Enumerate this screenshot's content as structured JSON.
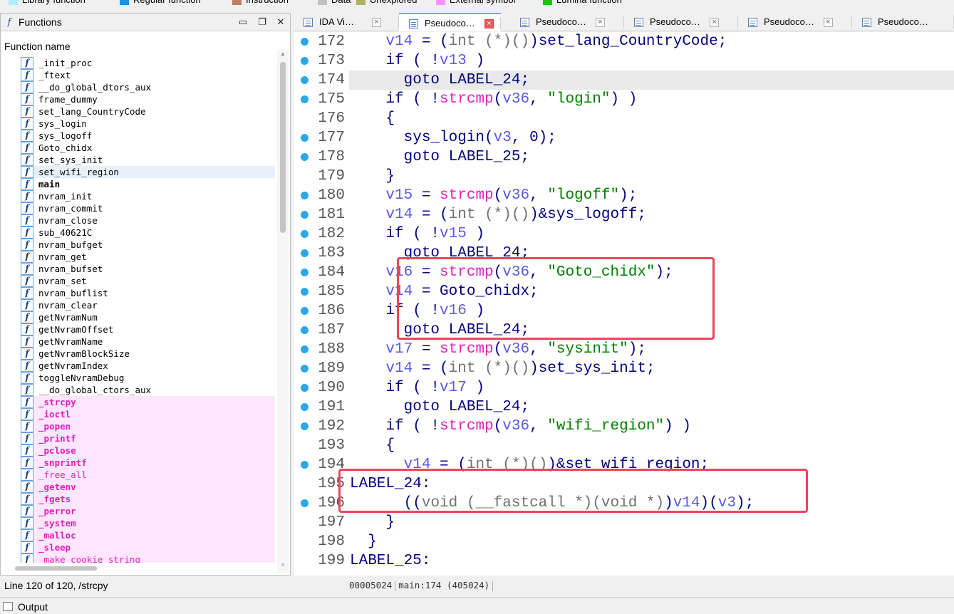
{
  "legend": [
    {
      "label": "Library function",
      "color": "#aeeeff"
    },
    {
      "label": "Regular function",
      "color": "#1e90e0"
    },
    {
      "label": "Instruction",
      "color": "#c08060"
    },
    {
      "label": "Data",
      "color": "#c0c0c0"
    },
    {
      "label": "Unexplored",
      "color": "#b0b060"
    },
    {
      "label": "External symbol",
      "color": "#ff90ff"
    },
    {
      "label": "Lumina function",
      "color": "#20c020"
    }
  ],
  "functions_panel": {
    "title": "Functions",
    "column_header": "Function name",
    "status": "Line 120 of 120, /strcpy",
    "items": [
      {
        "name": "_init_proc",
        "bold": false,
        "lib": false
      },
      {
        "name": "_ftext",
        "bold": false,
        "lib": false
      },
      {
        "name": "__do_global_dtors_aux",
        "bold": false,
        "lib": false
      },
      {
        "name": "frame_dummy",
        "bold": false,
        "lib": false
      },
      {
        "name": "set_lang_CountryCode",
        "bold": false,
        "lib": false
      },
      {
        "name": "sys_login",
        "bold": false,
        "lib": false
      },
      {
        "name": "sys_logoff",
        "bold": false,
        "lib": false
      },
      {
        "name": "Goto_chidx",
        "bold": false,
        "lib": false
      },
      {
        "name": "set_sys_init",
        "bold": false,
        "lib": false
      },
      {
        "name": "set_wifi_region",
        "bold": false,
        "lib": false,
        "selected": true
      },
      {
        "name": "main",
        "bold": true,
        "lib": false
      },
      {
        "name": "nvram_init",
        "bold": false,
        "lib": false
      },
      {
        "name": "nvram_commit",
        "bold": false,
        "lib": false
      },
      {
        "name": "nvram_close",
        "bold": false,
        "lib": false
      },
      {
        "name": "sub_40621C",
        "bold": false,
        "lib": false
      },
      {
        "name": "nvram_bufget",
        "bold": false,
        "lib": false
      },
      {
        "name": "nvram_get",
        "bold": false,
        "lib": false
      },
      {
        "name": "nvram_bufset",
        "bold": false,
        "lib": false
      },
      {
        "name": "nvram_set",
        "bold": false,
        "lib": false
      },
      {
        "name": "nvram_buflist",
        "bold": false,
        "lib": false
      },
      {
        "name": "nvram_clear",
        "bold": false,
        "lib": false
      },
      {
        "name": "getNvramNum",
        "bold": false,
        "lib": false
      },
      {
        "name": "getNvramOffset",
        "bold": false,
        "lib": false
      },
      {
        "name": "getNvramName",
        "bold": false,
        "lib": false
      },
      {
        "name": "getNvramBlockSize",
        "bold": false,
        "lib": false
      },
      {
        "name": "getNvramIndex",
        "bold": false,
        "lib": false
      },
      {
        "name": "toggleNvramDebug",
        "bold": false,
        "lib": false
      },
      {
        "name": "__do_global_ctors_aux",
        "bold": false,
        "lib": false
      },
      {
        "name": "_strcpy",
        "bold": true,
        "lib": true
      },
      {
        "name": "_ioctl",
        "bold": true,
        "lib": true
      },
      {
        "name": "_popen",
        "bold": true,
        "lib": true
      },
      {
        "name": "_printf",
        "bold": true,
        "lib": true
      },
      {
        "name": "_pclose",
        "bold": true,
        "lib": true
      },
      {
        "name": "_snprintf",
        "bold": true,
        "lib": true
      },
      {
        "name": "_free_all",
        "bold": false,
        "lib": true
      },
      {
        "name": "_getenv",
        "bold": true,
        "lib": true
      },
      {
        "name": "_fgets",
        "bold": true,
        "lib": true
      },
      {
        "name": "_perror",
        "bold": true,
        "lib": true
      },
      {
        "name": "_system",
        "bold": true,
        "lib": true
      },
      {
        "name": "_malloc",
        "bold": true,
        "lib": true
      },
      {
        "name": "_sleep",
        "bold": true,
        "lib": true
      },
      {
        "name": "_make_cookie_string",
        "bold": false,
        "lib": true
      }
    ]
  },
  "tabs": [
    {
      "label": "IDA Vi…",
      "active": false
    },
    {
      "label": "Pseudoco…",
      "active": true
    },
    {
      "label": "Pseudoco…",
      "active": false
    },
    {
      "label": "Pseudoco…",
      "active": false
    },
    {
      "label": "Pseudoco…",
      "active": false
    },
    {
      "label": "Pseudoco…",
      "active": false
    }
  ],
  "code_lines": [
    {
      "num": "172",
      "dot": true,
      "html": "    <span class=\"var\">v14</span> = (<span class=\"typ\">int</span> <span class=\"typ\">(*)()</span>)set_lang_CountryCode;"
    },
    {
      "num": "173",
      "dot": true,
      "html": "    if ( !<span class=\"var\">v13</span> )"
    },
    {
      "num": "174",
      "dot": true,
      "hl": true,
      "html": "      goto LABEL_24;"
    },
    {
      "num": "175",
      "dot": true,
      "html": "    if ( !<span class=\"lib\">strcmp</span>(<span class=\"var\">v36</span>, <span class=\"str\">\"login\"</span>) )"
    },
    {
      "num": "176",
      "dot": false,
      "html": "    {"
    },
    {
      "num": "177",
      "dot": true,
      "html": "      sys_login(<span class=\"var\">v3</span>, 0);"
    },
    {
      "num": "178",
      "dot": true,
      "html": "      goto LABEL_25;"
    },
    {
      "num": "179",
      "dot": false,
      "html": "    }"
    },
    {
      "num": "180",
      "dot": true,
      "html": "    <span class=\"var\">v15</span> = <span class=\"lib\">strcmp</span>(<span class=\"var\">v36</span>, <span class=\"str\">\"logoff\"</span>);"
    },
    {
      "num": "181",
      "dot": true,
      "html": "    <span class=\"var\">v14</span> = (<span class=\"typ\">int</span> <span class=\"typ\">(*)()</span>)&amp;sys_logoff;"
    },
    {
      "num": "182",
      "dot": true,
      "html": "    if ( !<span class=\"var\">v15</span> )"
    },
    {
      "num": "183",
      "dot": true,
      "html": "      goto LABEL_24;"
    },
    {
      "num": "184",
      "dot": true,
      "html": "    <span class=\"var\">v16</span> = <span class=\"lib\">strcmp</span>(<span class=\"var\">v36</span>, <span class=\"str\">\"Goto_chidx\"</span>);"
    },
    {
      "num": "185",
      "dot": true,
      "html": "    <span class=\"var\">v14</span> = Goto_chidx;"
    },
    {
      "num": "186",
      "dot": true,
      "html": "    if ( !<span class=\"var\">v16</span> )"
    },
    {
      "num": "187",
      "dot": true,
      "html": "      goto LABEL_24;"
    },
    {
      "num": "188",
      "dot": true,
      "html": "    <span class=\"var\">v17</span> = <span class=\"lib\">strcmp</span>(<span class=\"var\">v36</span>, <span class=\"str\">\"sysinit\"</span>);"
    },
    {
      "num": "189",
      "dot": true,
      "html": "    <span class=\"var\">v14</span> = (<span class=\"typ\">int</span> <span class=\"typ\">(*)()</span>)set_sys_init;"
    },
    {
      "num": "190",
      "dot": true,
      "html": "    if ( !<span class=\"var\">v17</span> )"
    },
    {
      "num": "191",
      "dot": true,
      "html": "      goto LABEL_24;"
    },
    {
      "num": "192",
      "dot": true,
      "html": "    if ( !<span class=\"lib\">strcmp</span>(<span class=\"var\">v36</span>, <span class=\"str\">\"wifi_region\"</span>) )"
    },
    {
      "num": "193",
      "dot": false,
      "html": "    {"
    },
    {
      "num": "194",
      "dot": true,
      "html": "      <span class=\"var\">v14</span> = (<span class=\"typ\">int</span> <span class=\"typ\">(*)()</span>)&amp;set_wifi_region;"
    },
    {
      "num": "195",
      "dot": false,
      "html": "LABEL_24:"
    },
    {
      "num": "196",
      "dot": true,
      "html": "      ((<span class=\"typ\">void</span> <span class=\"typ\">(__fastcall *)(void *)</span>)<span class=\"var\">v14</span>)(<span class=\"var\">v3</span>);"
    },
    {
      "num": "197",
      "dot": false,
      "html": "    }"
    },
    {
      "num": "198",
      "dot": false,
      "html": "  }"
    },
    {
      "num": "199",
      "dot": false,
      "html": "LABEL_25:"
    }
  ],
  "code_status": {
    "address": "00005024",
    "location": "main:174",
    "offset": "(405024)"
  },
  "output_label": "Output"
}
